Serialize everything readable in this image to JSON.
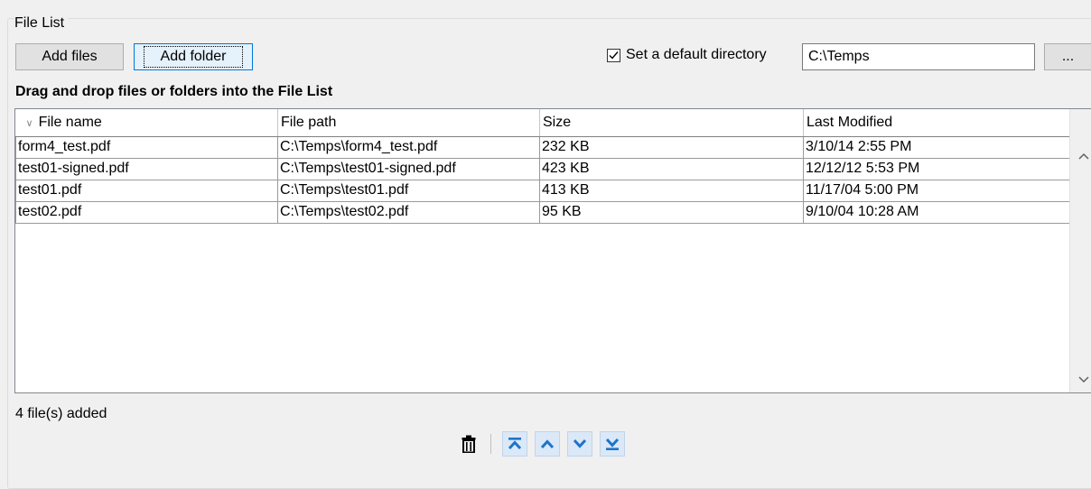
{
  "group": {
    "title": "File List"
  },
  "buttons": {
    "add_files": "Add files",
    "add_folder": "Add folder",
    "browse": "..."
  },
  "default_dir": {
    "checked": true,
    "label": "Set a default directory",
    "value": "C:\\Temps"
  },
  "hint": "Drag and drop files or folders into the File List",
  "table": {
    "columns": [
      "File name",
      "File path",
      "Size",
      "Last Modified"
    ],
    "rows": [
      [
        "form4_test.pdf",
        "C:\\Temps\\form4_test.pdf",
        "232 KB",
        "3/10/14 2:55 PM"
      ],
      [
        "test01-signed.pdf",
        "C:\\Temps\\test01-signed.pdf",
        "423 KB",
        "12/12/12 5:53 PM"
      ],
      [
        "test01.pdf",
        "C:\\Temps\\test01.pdf",
        "413 KB",
        "11/17/04 5:00 PM"
      ],
      [
        "test02.pdf",
        "C:\\Temps\\test02.pdf",
        "95 KB",
        "9/10/04 10:28 AM"
      ]
    ]
  },
  "status": "4 file(s) added",
  "icons": {
    "accent": "#1e74c8",
    "toolbar": [
      "trash-icon",
      "move-to-top-icon",
      "move-up-icon",
      "move-down-icon",
      "move-to-bottom-icon"
    ]
  }
}
